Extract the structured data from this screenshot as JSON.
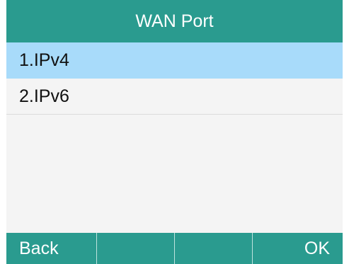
{
  "header": {
    "title": "WAN Port"
  },
  "menu": {
    "selected_index": 0,
    "items": [
      {
        "label": "1.IPv4"
      },
      {
        "label": "2.IPv6"
      }
    ]
  },
  "softkeys": [
    {
      "label": "Back"
    },
    {
      "label": ""
    },
    {
      "label": ""
    },
    {
      "label": "OK"
    }
  ],
  "colors": {
    "bar": "#2a9b8f",
    "selection": "#a8dbfa",
    "background": "#f4f4f4"
  }
}
